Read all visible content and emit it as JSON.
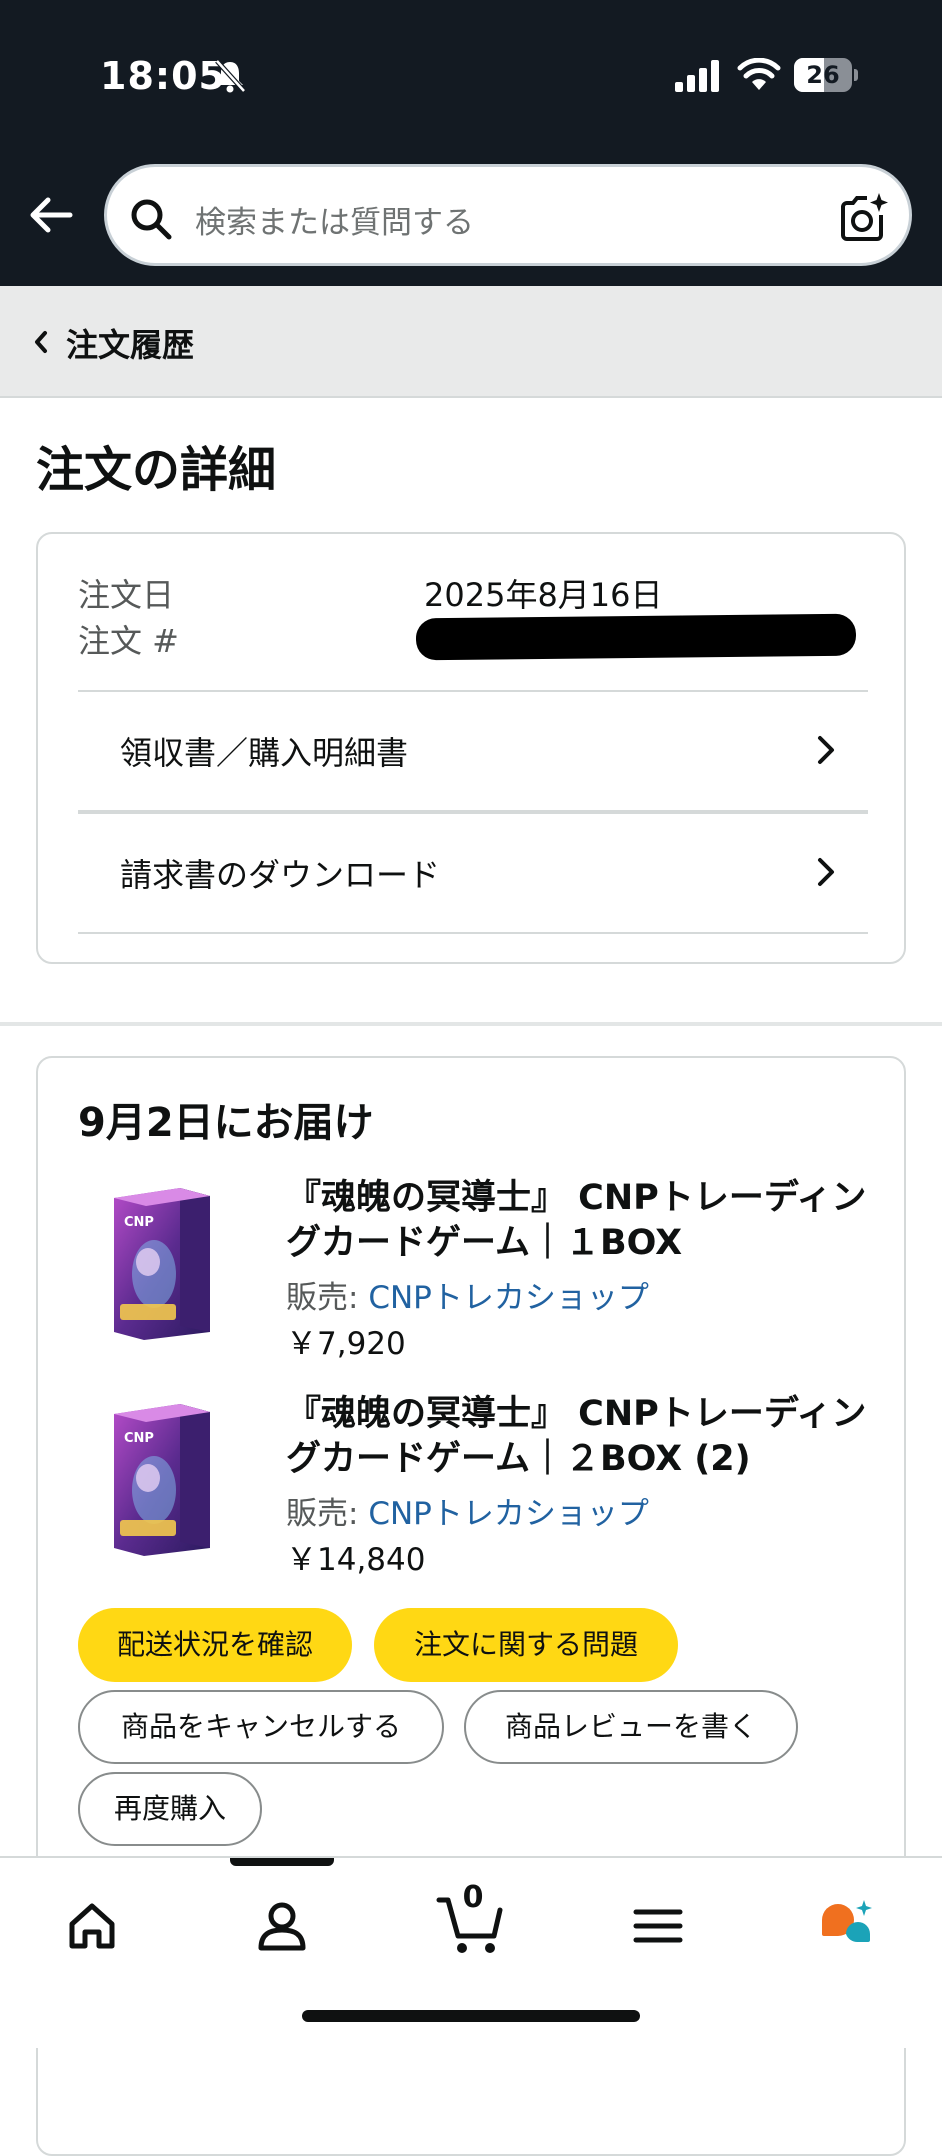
{
  "status_bar": {
    "time": "18:05",
    "battery": "26"
  },
  "search": {
    "placeholder": "検索または質問する"
  },
  "breadcrumb": {
    "label": "注文履歴"
  },
  "page": {
    "title": "注文の詳細"
  },
  "order": {
    "date_label": "注文日",
    "date_value": "2025年8月16日",
    "number_label": "注文 #",
    "links": [
      {
        "label": "領収書／購入明細書"
      },
      {
        "label": "請求書のダウンロード"
      }
    ]
  },
  "shipment": {
    "title": "9月2日にお届け",
    "items": [
      {
        "title": "『魂魄の冥導士』 CNPトレーディングカードゲーム｜１BOX",
        "seller_prefix": "販売: ",
        "seller": "CNPトレカショップ",
        "price": "￥7,920"
      },
      {
        "title": "『魂魄の冥導士』 CNPトレーディングカードゲーム｜２BOX (2)",
        "seller_prefix": "販売: ",
        "seller": "CNPトレカショップ",
        "price": "￥14,840"
      }
    ],
    "buttons": {
      "track": "配送状況を確認",
      "problem": "注文に関する問題",
      "cancel": "商品をキャンセルする",
      "review": "商品レビューを書く",
      "rebuy": "再度購入"
    }
  },
  "tabbar": {
    "cart_count": "0"
  },
  "colors": {
    "header_bg": "#131a22",
    "accent_yellow": "#ffd814",
    "link_blue": "#2162a1"
  }
}
